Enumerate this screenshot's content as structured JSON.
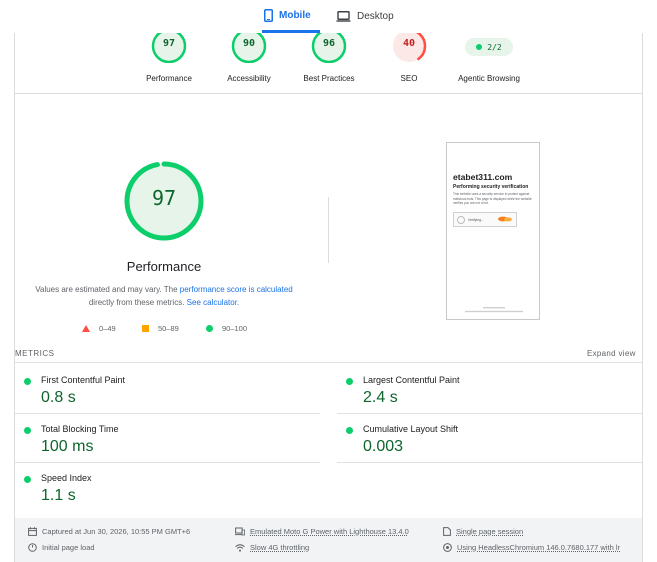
{
  "tabs": [
    {
      "label": "Mobile",
      "icon": "phone-icon",
      "active": true
    },
    {
      "label": "Desktop",
      "icon": "laptop-icon",
      "active": false
    }
  ],
  "category_scores": [
    {
      "label": "Performance",
      "score": "97",
      "value": 97,
      "status": "pass"
    },
    {
      "label": "Accessibility",
      "score": "90",
      "value": 90,
      "status": "pass"
    },
    {
      "label": "Best Practices",
      "score": "96",
      "value": 96,
      "status": "pass"
    },
    {
      "label": "SEO",
      "score": "40",
      "value": 40,
      "status": "fail"
    },
    {
      "label": "Agentic Browsing",
      "score": "2/2",
      "status": "pass"
    }
  ],
  "main_gauge": {
    "score": "97",
    "value": 97,
    "title": "Performance",
    "desc_prefix": "Values are estimated and may vary. The ",
    "desc_link1": "performance score is calculated",
    "desc_mid": " directly from these metrics. ",
    "desc_link2": "See calculator."
  },
  "legend": [
    {
      "range": "0–49",
      "shape": "triangle",
      "color": "#ff4e42"
    },
    {
      "range": "50–89",
      "shape": "square",
      "color": "#ffa400"
    },
    {
      "range": "90–100",
      "shape": "circle",
      "color": "#0cce6b"
    }
  ],
  "screenshot": {
    "site": "etabet311.com",
    "heading": "Performing security verification",
    "body": "This website uses a security service to protect against malicious bots. This page is displayed while the website verifies you are not a bot.",
    "widget_text": "Verifying..."
  },
  "metrics": {
    "title": "METRICS",
    "expand": "Expand view",
    "items": [
      {
        "name": "First Contentful Paint",
        "value": "0.8 s"
      },
      {
        "name": "Largest Contentful Paint",
        "value": "2.4 s"
      },
      {
        "name": "Total Blocking Time",
        "value": "100 ms"
      },
      {
        "name": "Cumulative Layout Shift",
        "value": "0.003"
      },
      {
        "name": "Speed Index",
        "value": "1.1 s"
      }
    ]
  },
  "footer": {
    "captured": "Captured at Jun 30, 2026, 10:55 PM GMT+6",
    "initial_load": "Initial page load",
    "device": "Emulated Moto G Power with Lighthouse 13.4.0",
    "throttling": "Slow 4G throttling",
    "session": "Single page session",
    "browser": "Using HeadlessChromium 146.0.7680.177 with lr"
  },
  "colors": {
    "pass": "#0cce6b",
    "pass_text": "#0d652d",
    "pass_bg": "#e6f4ea",
    "fail": "#ff4e42",
    "fail_text": "#c5221f",
    "fail_bg": "#fce8e6",
    "accent": "#1a73e8"
  }
}
